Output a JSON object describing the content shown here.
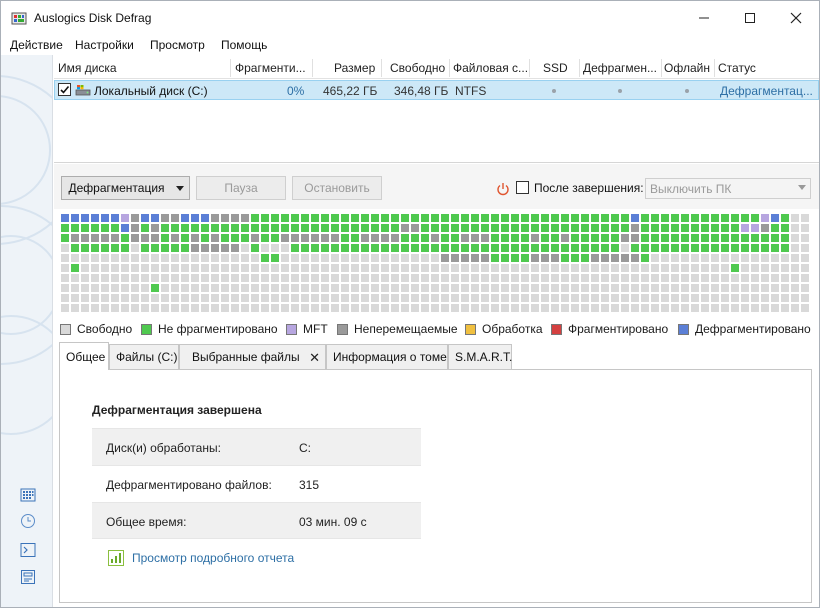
{
  "window": {
    "title": "Auslogics Disk Defrag"
  },
  "menu": [
    "Действие",
    "Настройки",
    "Просмотр",
    "Помощь"
  ],
  "table": {
    "headers": [
      "Имя диска",
      "Фрагменти...",
      "Размер",
      "Свободно",
      "Файловая с...",
      "SSD",
      "Дефрагмен...",
      "Офлайн",
      "Статус"
    ],
    "rows": [
      {
        "name": "Локальный диск (C:)",
        "fragmented": "0%",
        "size": "465,22 ГБ",
        "free": "346,48 ГБ",
        "fs": "NTFS",
        "status": "Дефрагментац...",
        "checked": true
      }
    ]
  },
  "toolbar": {
    "defrag": "Дефрагментация",
    "pause": "Пауза",
    "stop": "Остановить",
    "after_label": "После завершения:",
    "after_value": "Выключить ПК"
  },
  "legend": [
    {
      "label": "Свободно",
      "color": "#d9d9d9"
    },
    {
      "label": "Не фрагментировано",
      "color": "#4fc94f"
    },
    {
      "label": "MFT",
      "color": "#b7a6e0"
    },
    {
      "label": "Неперемещаемые",
      "color": "#9a9a9a"
    },
    {
      "label": "Обработка",
      "color": "#f0c040"
    },
    {
      "label": "Фрагментировано",
      "color": "#d44040"
    },
    {
      "label": "Дефрагментировано",
      "color": "#5b7fd6"
    }
  ],
  "tabs": [
    "Общее",
    "Файлы (C:)",
    "Выбранные файлы",
    "Информация о томе",
    "S.M.A.R.T."
  ],
  "panel": {
    "title": "Дефрагментация завершена",
    "stats": [
      {
        "label": "Диск(и) обработаны:",
        "value": "C:"
      },
      {
        "label": "Дефрагментировано файлов:",
        "value": "315"
      },
      {
        "label": "Общее время:",
        "value": "03 мин. 09 с"
      }
    ],
    "report_link": "Просмотр подробного отчета"
  },
  "icons": {
    "app": "defrag-app-icon",
    "sidebar": [
      "cluster-map-icon",
      "clock-icon",
      "console-icon",
      "disk-report-icon"
    ]
  }
}
